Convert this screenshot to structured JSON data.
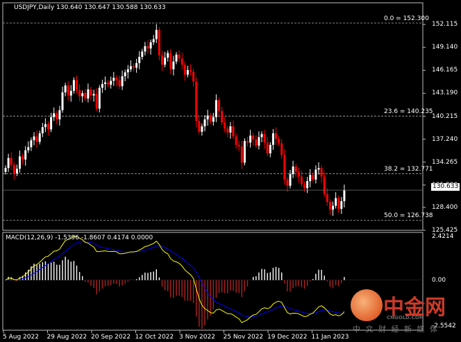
{
  "header": {
    "symbol": "USDJPY,Daily",
    "ohlc": "130.640 130.647 130.588 130.633"
  },
  "macd_header": "MACD(12,26,9) -1.5396 -1.8607 0.4174 0.0000",
  "current_price": "130.633",
  "price_axis": [
    "152.115",
    "149.140",
    "146.165",
    "143.190",
    "140.215",
    "137.240",
    "134.265",
    "131.290",
    "128.400",
    "125.425"
  ],
  "macd_axis": [
    "2.4214",
    "0.00",
    "-2.5542"
  ],
  "fib_levels": [
    {
      "label": "0.0 = 152.300",
      "value": 152.3
    },
    {
      "label": "23.6 = 140.235",
      "value": 140.235
    },
    {
      "label": "38.2 = 132.771",
      "value": 132.771
    },
    {
      "label": "50.0 = 126.738",
      "value": 126.738
    }
  ],
  "time_axis": [
    "5 Aug 2022",
    "29 Aug 2022",
    "20 Sep 2022",
    "12 Oct 2022",
    "3 Nov 2022",
    "25 Nov 2022",
    "19 Dec 2022",
    "11 Jan 2023"
  ],
  "watermark": {
    "logo": "中金网",
    "domain": "CNGOLD.COM",
    "tagline": "中 文 财 经 新 媒 体"
  },
  "colors": {
    "bull": "#ffffff",
    "bear": "#ff0000",
    "grid": "#c0c0c0",
    "macd_line": "#ffff00",
    "signal_line": "#0000ff",
    "hist_up": "#ffffff",
    "hist_down": "#b22222"
  },
  "chart_data": {
    "type": "candlestick",
    "price_range": [
      125.425,
      153.3
    ],
    "closes": [
      133.5,
      134.8,
      133.9,
      132.8,
      133.4,
      135.0,
      134.6,
      135.8,
      136.2,
      137.1,
      137.6,
      136.9,
      138.0,
      138.8,
      139.2,
      138.5,
      140.1,
      140.6,
      139.8,
      141.0,
      143.3,
      144.2,
      142.9,
      143.5,
      144.9,
      143.6,
      142.8,
      143.2,
      142.5,
      143.7,
      142.9,
      143.1,
      141.2,
      143.9,
      144.4,
      144.6,
      144.3,
      144.8,
      145.2,
      144.9,
      144.1,
      145.4,
      145.9,
      146.3,
      146.7,
      146.5,
      147.1,
      147.9,
      148.6,
      149.3,
      149.0,
      149.8,
      150.2,
      151.4,
      148.1,
      146.9,
      147.8,
      148.4,
      146.3,
      147.3,
      148.2,
      147.7,
      146.9,
      145.6,
      146.2,
      146.0,
      144.7,
      139.6,
      138.2,
      138.9,
      139.8,
      140.3,
      139.5,
      140.1,
      142.3,
      140.9,
      139.4,
      138.6,
      138.1,
      138.9,
      137.6,
      136.5,
      136.3,
      134.2,
      137.0,
      136.8,
      137.7,
      137.2,
      136.4,
      137.5,
      137.9,
      136.8,
      135.4,
      136.5,
      138.0,
      137.3,
      136.7,
      135.2,
      132.0,
      131.2,
      132.7,
      133.7,
      133.0,
      132.4,
      131.4,
      130.9,
      131.8,
      132.6,
      132.0,
      133.3,
      133.5,
      132.4,
      130.1,
      129.1,
      128.1,
      128.6,
      129.6,
      128.2,
      129.2,
      130.6
    ],
    "macd_range": [
      -2.5542,
      2.4214
    ],
    "macd": {
      "note": "histogram with yellow MACD line and blue signal line"
    }
  }
}
